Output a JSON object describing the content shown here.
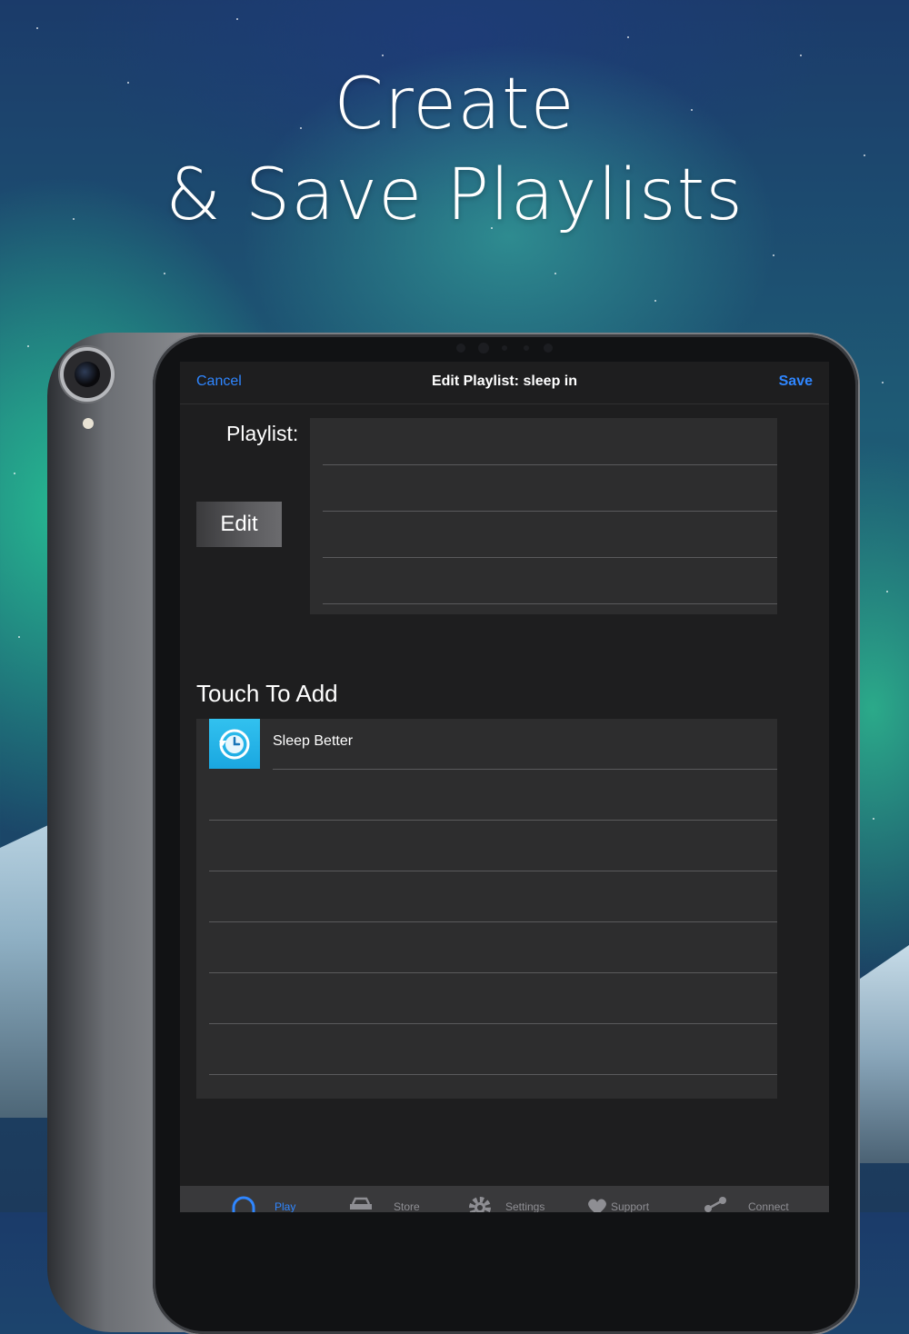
{
  "headline": {
    "line1": "Create",
    "line2": "& Save Playlists"
  },
  "navbar": {
    "cancel_label": "Cancel",
    "title": "Edit Playlist: sleep in",
    "save_label": "Save"
  },
  "playlist": {
    "label": "Playlist:",
    "edit_label": "Edit"
  },
  "touch_to_add": {
    "label": "Touch To Add",
    "items": [
      {
        "label": "Sleep Better",
        "icon": "clock-rewind-icon"
      }
    ]
  },
  "tabbar": {
    "tabs": [
      {
        "label": "Play",
        "icon": "headphones-icon",
        "active": true
      },
      {
        "label": "Store",
        "icon": "store-icon",
        "active": false
      },
      {
        "label": "Settings",
        "icon": "gear-icon",
        "active": false
      },
      {
        "label": "Support",
        "icon": "heart-icon",
        "active": false
      },
      {
        "label": "Connect",
        "icon": "share-icon",
        "active": false
      }
    ]
  },
  "colors": {
    "accent": "#2f86ff",
    "screen_bg": "#1e1e1f",
    "panel_bg": "#2d2d2e"
  }
}
